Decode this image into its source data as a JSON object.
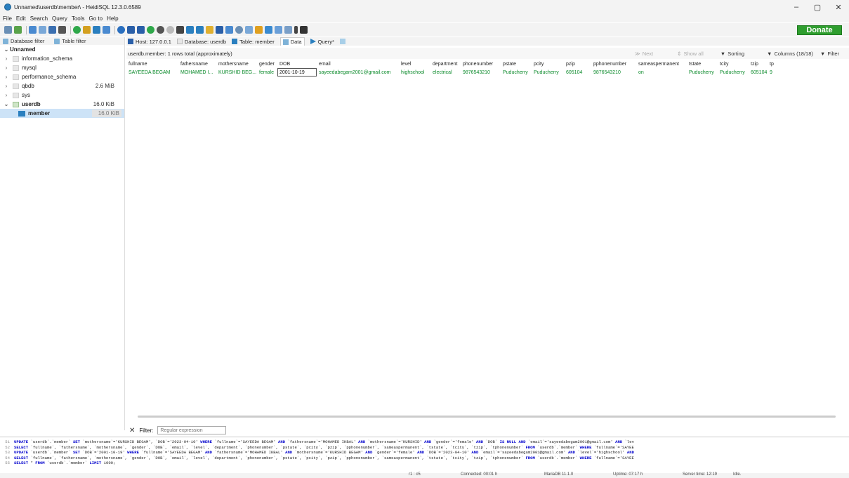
{
  "window": {
    "title": "Unnamed\\userdb\\member\\ - HeidiSQL 12.3.0.6589",
    "controls": [
      "–",
      "▢",
      "✕"
    ]
  },
  "menu": [
    "File",
    "Edit",
    "Search",
    "Query",
    "Tools",
    "Go to",
    "Help"
  ],
  "donate_label": "Donate",
  "sidebar": {
    "database_filter": "Database filter",
    "table_filter": "Table filter",
    "session": "Unnamed",
    "databases": [
      {
        "name": "information_schema",
        "size": ""
      },
      {
        "name": "mysql",
        "size": ""
      },
      {
        "name": "performance_schema",
        "size": ""
      },
      {
        "name": "qbdb",
        "size": "2.6 MiB"
      },
      {
        "name": "sys",
        "size": ""
      },
      {
        "name": "userdb",
        "size": "16.0 KiB"
      }
    ],
    "table": {
      "name": "member",
      "size": "16.0 KiB"
    }
  },
  "tabs": {
    "host": "Host: 127.0.0.1",
    "database": "Database: userdb",
    "table": "Table: member",
    "data": "Data",
    "query": "Query*"
  },
  "grid": {
    "info": "userdb.member: 1 rows total (approximately)",
    "actions": {
      "next": "Next",
      "show_all": "Show all",
      "sorting": "Sorting",
      "columns": "Columns (18/18)",
      "filter": "Filter"
    },
    "columns": [
      "fullname",
      "fathersname",
      "mothersname",
      "gender",
      "DOB",
      "email",
      "level",
      "department",
      "phonenumber",
      "pstate",
      "pcity",
      "pzip",
      "pphonenumber",
      "sameaspermanent",
      "tstate",
      "tcity",
      "tzip",
      "tp"
    ],
    "rows": [
      [
        "SAYEEDA BEGAM",
        "MOHAMED I...",
        "KURSHID BEG...",
        "female",
        "2001-10-19",
        "sayeedabegam2001@gmail.com",
        "highschool",
        "electrical",
        "9876543210",
        "Puducherry",
        "Puducherry",
        "605104",
        "9876543210",
        "on",
        "Puducherry",
        "Puducherry",
        "605104",
        "9"
      ]
    ]
  },
  "filterbar": {
    "label": "Filter:",
    "placeholder": "Regular expression"
  },
  "sqllog": [
    {
      "n": "51",
      "text": "UPDATE `userdb`.`member` SET `mothersname`='KURSHID BEGAM', `DOB`='2023-04-10' WHERE  `fullname`='SAYEEDA BEGAM' AND `fathersname`='MOHAMED IKBAL' AND `mothersname`='KURSHID' AND `gender`='female' AND `DOB` IS NULL AND `email`='sayeedabegam2001@gmail.com' AND `lev"
    },
    {
      "n": "52",
      "text": "SELECT `fullname`, `fathersname`, `mothersname`, `gender`, `DOB`, `email`, `level`, `department`, `phonenumber`, `pstate`, `pcity`, `pzip`, `pphonenumber`, `sameaspermanent`, `tstate`, `tcity`, `tzip`, `tphonenumber` FROM `userdb`.`member` WHERE  `fullname`='SAYEE"
    },
    {
      "n": "53",
      "text": "UPDATE `userdb`.`member` SET `DOB`='2001-10-19' WHERE  `fullname`='SAYEEDA BEGAM' AND `fathersname`='MOHAMED IKBAL' AND `mothersname`='KURSHID BEGAM' AND `gender`='female' AND `DOB`='2023-04-10' AND `email`='sayeedabegam2001@gmail.com' AND `level`='highschool' AND"
    },
    {
      "n": "54",
      "text": "SELECT `fullname`, `fathersname`, `mothersname`, `gender`, `DOB`, `email`, `level`, `department`, `phonenumber`, `pstate`, `pcity`, `pzip`, `pphonenumber`, `sameaspermanent`, `tstate`, `tcity`, `tzip`, `tphonenumber` FROM `userdb`.`member` WHERE  `fullname`='SAYEE"
    },
    {
      "n": "55",
      "text": "SELECT * FROM `userdb`.`member` LIMIT 1000;"
    }
  ],
  "statusbar": {
    "position": "r1 : c5",
    "connected": "Connected: 00:01 h",
    "server": "MariaDB 11.1.0",
    "uptime": "Uptime: 07:17 h",
    "server_time": "Server time: 12:19",
    "state": "Idle."
  },
  "colors": {
    "accent": "#2a7fbf",
    "donate": "#2f9e2f",
    "cell_text": "#0a8a2a"
  }
}
